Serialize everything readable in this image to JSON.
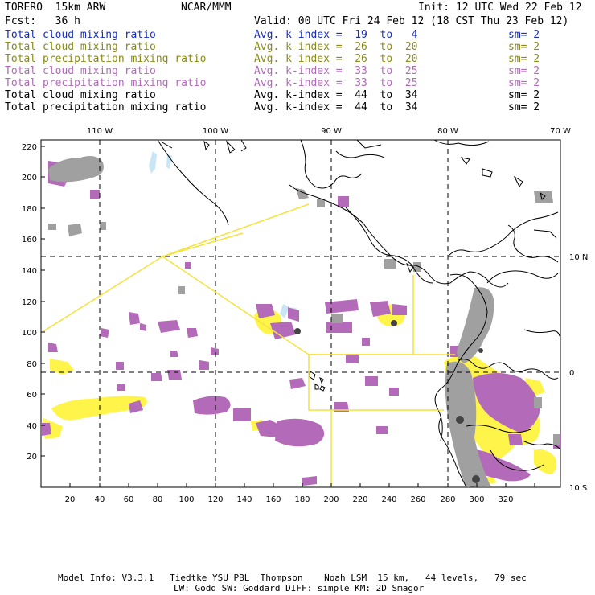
{
  "header": {
    "model": "TORERO  15km ARW",
    "center": "NCAR/MMM",
    "init": "Init: 12 UTC Wed 22 Feb 12",
    "fcst": "Fcst:   36 h",
    "valid": "Valid: 00 UTC Fri 24 Feb 12 (18 CST Thu 23 Feb 12)"
  },
  "legend": [
    {
      "field": "Total cloud mixing ratio",
      "kindex": "Avg. k-index =  19  to   4",
      "sm": "sm= 2",
      "color": "#1a2fb8"
    },
    {
      "field": "Total cloud mixing ratio",
      "kindex": "Avg. k-index =  26  to  20",
      "sm": "sm= 2",
      "color": "#8a8a1a"
    },
    {
      "field": "Total precipitation mixing ratio",
      "kindex": "Avg. k-index =  26  to  20",
      "sm": "sm= 2",
      "color": "#8a8a1a"
    },
    {
      "field": "Total cloud mixing ratio",
      "kindex": "Avg. k-index =  33  to  25",
      "sm": "sm= 2",
      "color": "#b06ab8"
    },
    {
      "field": "Total precipitation mixing ratio",
      "kindex": "Avg. k-index =  33  to  25",
      "sm": "sm= 2",
      "color": "#b06ab8"
    },
    {
      "field": "Total cloud mixing ratio",
      "kindex": "Avg. k-index =  44  to  34",
      "sm": "sm= 2",
      "color": "#000000"
    },
    {
      "field": "Total precipitation mixing ratio",
      "kindex": "Avg. k-index =  44  to  34",
      "sm": "sm= 2",
      "color": "#000000"
    }
  ],
  "axes": {
    "lon_labels": [
      "110 W",
      "100 W",
      "90 W",
      "80 W",
      "70 W"
    ],
    "lat_labels": [
      "10 N",
      "0",
      "10 S"
    ],
    "x_ticks": [
      "20",
      "40",
      "60",
      "80",
      "100",
      "120",
      "140",
      "160",
      "180",
      "200",
      "220",
      "240",
      "260",
      "280",
      "300",
      "320"
    ],
    "y_ticks": [
      "220",
      "200",
      "180",
      "160",
      "140",
      "120",
      "100",
      "80",
      "60",
      "40",
      "20"
    ]
  },
  "footer": {
    "line1": "Model Info: V3.3.1   Tiedtke YSU PBL  Thompson    Noah LSM  15 km,   44 levels,   79 sec",
    "line2": "LW: Godd SW: Goddard DIFF: simple KM: 2D Smagor"
  },
  "colors": {
    "light_blue": "#c8e6f5",
    "yellow": "#fff44a",
    "purple": "#b36ab8",
    "gray": "#a0a0a0",
    "dark_gray": "#555555",
    "box_yellow": "#f5e23a"
  }
}
